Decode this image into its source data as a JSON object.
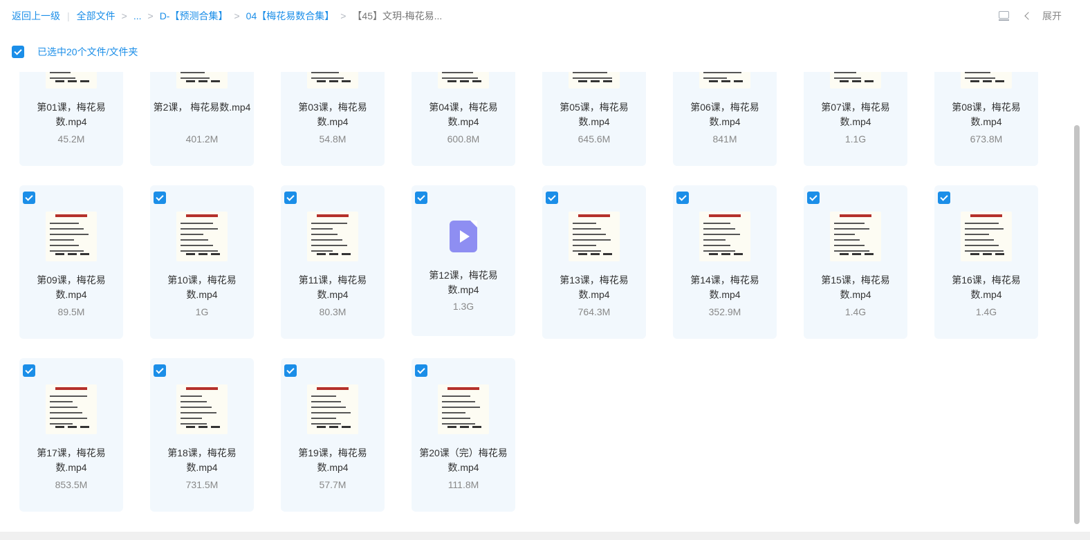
{
  "breadcrumb": {
    "back": "返回上一级",
    "all_files": "全部文件",
    "ellipsis": "...",
    "d_folder": "D-【预测合集】",
    "folder_04": "04【梅花易数合集】",
    "current": "【45】文玥-梅花易..."
  },
  "toolbar": {
    "expand": "展开"
  },
  "selection": {
    "label": "已选中20个文件/文件夹"
  },
  "files": [
    {
      "name": "第01课，梅花易数.mp4",
      "size": "45.2M"
    },
    {
      "name": "第2课， 梅花易数.mp4",
      "size": "401.2M"
    },
    {
      "name": "第03课，梅花易数.mp4",
      "size": "54.8M"
    },
    {
      "name": "第04课，梅花易数.mp4",
      "size": "600.8M"
    },
    {
      "name": "第05课，梅花易数.mp4",
      "size": "645.6M"
    },
    {
      "name": "第06课，梅花易数.mp4",
      "size": "841M"
    },
    {
      "name": "第07课，梅花易数.mp4",
      "size": "1.1G"
    },
    {
      "name": "第08课，梅花易数.mp4",
      "size": "673.8M"
    },
    {
      "name": "第09课，梅花易数.mp4",
      "size": "89.5M"
    },
    {
      "name": "第10课，梅花易数.mp4",
      "size": "1G"
    },
    {
      "name": "第11课，梅花易数.mp4",
      "size": "80.3M"
    },
    {
      "name": "第12课，梅花易数.mp4",
      "size": "1.3G"
    },
    {
      "name": "第13课，梅花易数.mp4",
      "size": "764.3M"
    },
    {
      "name": "第14课，梅花易数.mp4",
      "size": "352.9M"
    },
    {
      "name": "第15课，梅花易数.mp4",
      "size": "1.4G"
    },
    {
      "name": "第16课，梅花易数.mp4",
      "size": "1.4G"
    },
    {
      "name": "第17课，梅花易数.mp4",
      "size": "853.5M"
    },
    {
      "name": "第18课，梅花易数.mp4",
      "size": "731.5M"
    },
    {
      "name": "第19课，梅花易数.mp4",
      "size": "57.7M"
    },
    {
      "name": "第20课（完）梅花易数.mp4",
      "size": "111.8M"
    }
  ],
  "colors": {
    "accent": "#1b8ee8",
    "card_bg": "#f2f8fd",
    "video_icon": "#8e8ef2"
  },
  "icons": {
    "checkbox": "checkbox-checked-icon",
    "video": "video-file-icon",
    "list_view": "list-view-icon",
    "chevron": "chevron-left-icon"
  }
}
